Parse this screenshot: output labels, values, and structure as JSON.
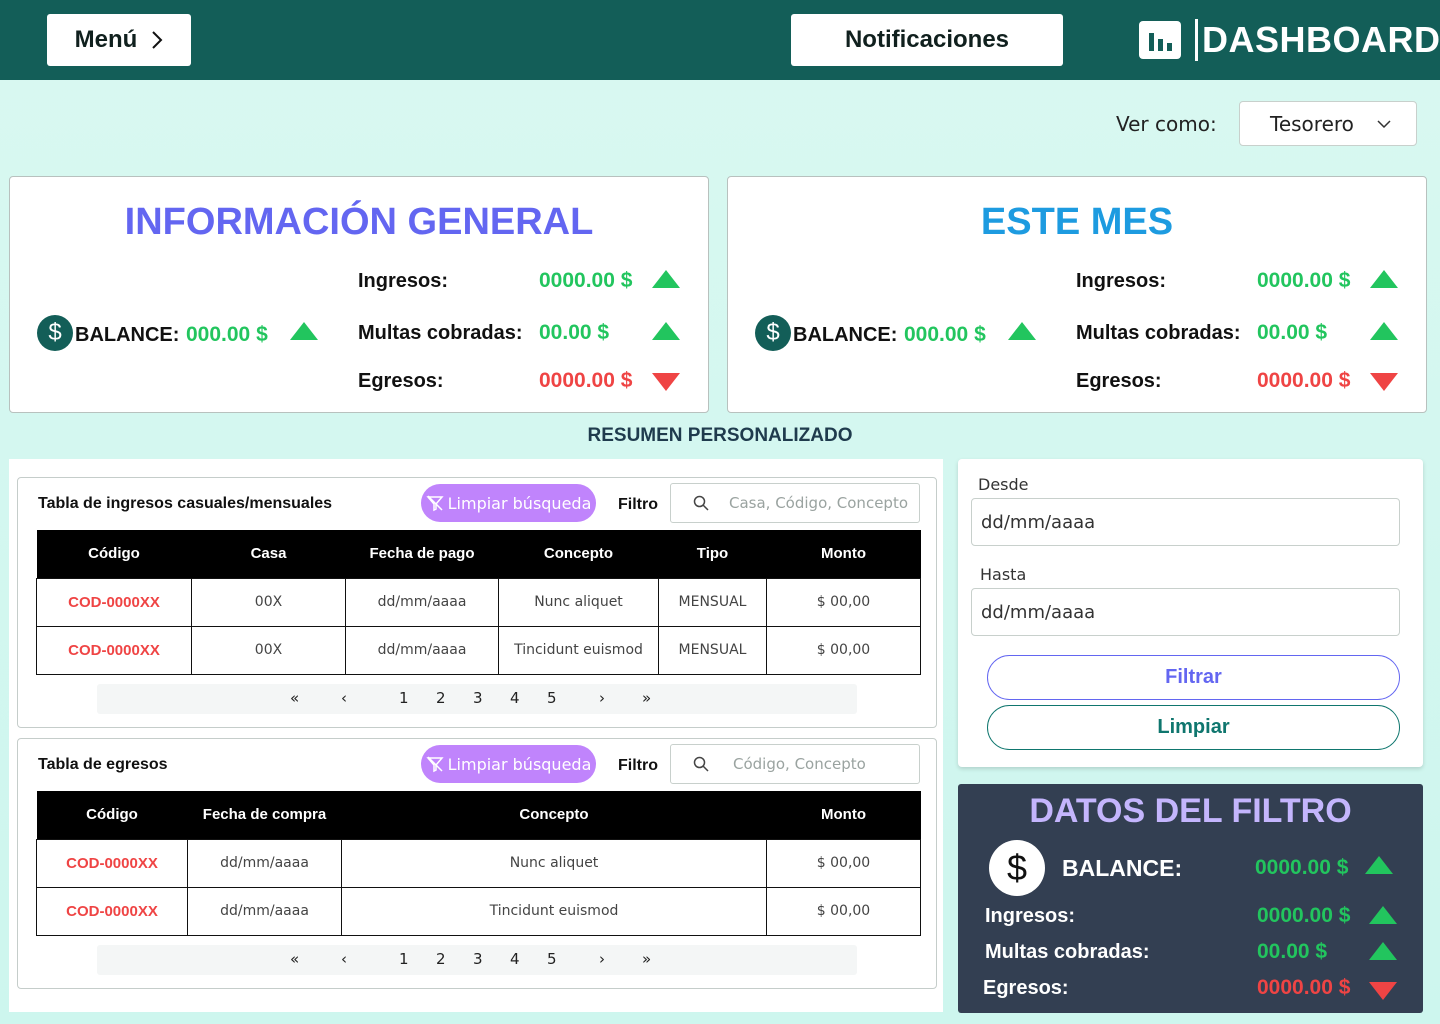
{
  "header": {
    "menu_label": "Menú",
    "notifications_label": "Notificaciones",
    "brand": "DASHBOARD"
  },
  "view_as": {
    "label": "Ver como:",
    "selected": "Tesorero"
  },
  "general": {
    "title": "INFORMACIÓN GENERAL",
    "balance_label": "BALANCE:",
    "balance_value": "000.00 $",
    "ingresos_label": "Ingresos:",
    "ingresos_value": "0000.00 $",
    "multas_label": "Multas cobradas:",
    "multas_value": "00.00 $",
    "egresos_label": "Egresos:",
    "egresos_value": "0000.00 $"
  },
  "month": {
    "title": "ESTE MES",
    "balance_label": "BALANCE:",
    "balance_value": "000.00 $",
    "ingresos_label": "Ingresos:",
    "ingresos_value": "0000.00 $",
    "multas_label": "Multas cobradas:",
    "multas_value": "00.00 $",
    "egresos_label": "Egresos:",
    "egresos_value": "0000.00 $"
  },
  "summary_title": "RESUMEN PERSONALIZADO",
  "income_table": {
    "title": "Tabla de ingresos casuales/mensuales",
    "clear_label": "Limpiar búsqueda",
    "filter_label": "Filtro",
    "search_placeholder": "Casa, Código, Concepto",
    "headers": [
      "Código",
      "Casa",
      "Fecha de pago",
      "Concepto",
      "Tipo",
      "Monto"
    ],
    "rows": [
      [
        "COD-0000XX",
        "00X",
        "dd/mm/aaaa",
        "Nunc aliquet",
        "MENSUAL",
        "$ 00,00"
      ],
      [
        "COD-0000XX",
        "00X",
        "dd/mm/aaaa",
        "Tincidunt euismod",
        "MENSUAL",
        "$ 00,00"
      ]
    ],
    "pages": [
      "1",
      "2",
      "3",
      "4",
      "5"
    ]
  },
  "expense_table": {
    "title": "Tabla de egresos",
    "clear_label": "Limpiar búsqueda",
    "filter_label": "Filtro",
    "search_placeholder": "Código, Concepto",
    "headers": [
      "Código",
      "Fecha de compra",
      "Concepto",
      "Monto"
    ],
    "rows": [
      [
        "COD-0000XX",
        "dd/mm/aaaa",
        "Nunc aliquet",
        "$ 00,00"
      ],
      [
        "COD-0000XX",
        "dd/mm/aaaa",
        "Tincidunt euismod",
        "$ 00,00"
      ]
    ],
    "pages": [
      "1",
      "2",
      "3",
      "4",
      "5"
    ]
  },
  "date_filter": {
    "from_label": "Desde",
    "from_placeholder": "dd/mm/aaaa",
    "to_label": "Hasta",
    "to_placeholder": "dd/mm/aaaa",
    "filter_button": "Filtrar",
    "clear_button": "Limpiar"
  },
  "filter_data": {
    "title": "DATOS DEL FILTRO",
    "balance_label": "BALANCE:",
    "balance_value": "0000.00 $",
    "ingresos_label": "Ingresos:",
    "ingresos_value": "0000.00 $",
    "multas_label": "Multas cobradas:",
    "multas_value": "00.00 $",
    "egresos_label": "Egresos:",
    "egresos_value": "0000.00 $"
  },
  "colors": {
    "header_bg": "#135e58",
    "positive": "#22c55e",
    "negative": "#ef4444",
    "general_title": "#6366f1",
    "month_title": "#1d9be0",
    "clear_button": "#c084fc",
    "filter_panel_bg": "#333f52"
  },
  "icons": {
    "menu": "chevron-right-icon",
    "brand": "bar-chart-icon",
    "select": "chevron-down-icon",
    "balance": "dollar-icon",
    "up": "triangle-up-icon",
    "down": "triangle-down-icon",
    "search": "search-icon",
    "clear": "filter-off-icon"
  }
}
